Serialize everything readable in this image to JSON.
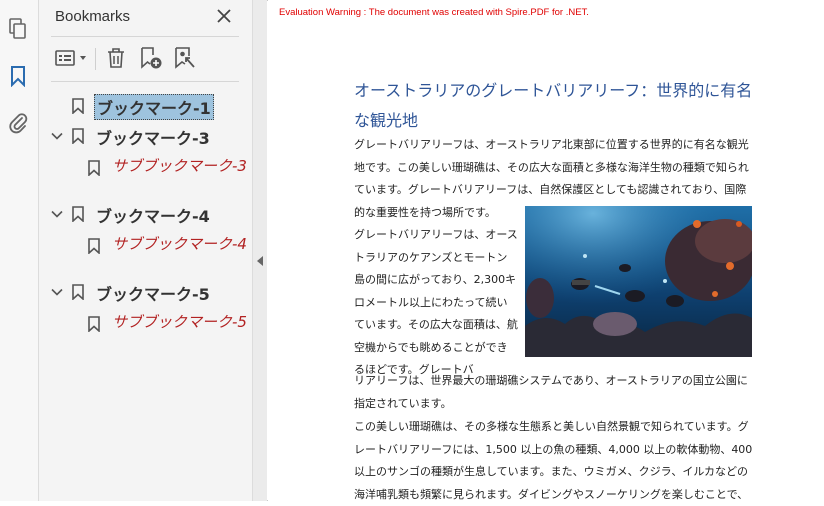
{
  "sidebar": {
    "title": "Bookmarks",
    "icons": [
      "pages-icon",
      "bookmark-panel-icon",
      "attachment-icon"
    ]
  },
  "toolbar": {
    "buttons": [
      "options-menu",
      "delete-bookmark",
      "new-bookmark",
      "bookmark-properties"
    ]
  },
  "bookmarks": {
    "b1": "ブックマーク-1",
    "b3": "ブックマーク-3",
    "b3_sub": "サブブックマーク-3",
    "b4": "ブックマーク-4",
    "b4_sub": "サブブックマーク-4",
    "b5": "ブックマーク-5",
    "b5_sub": "サブブックマーク-5"
  },
  "document": {
    "warning": "Evaluation Warning : The document was created with Spire.PDF for .NET.",
    "heading": "オーストラリアのグレートバリアリーフ：世界的に有名な観光地",
    "p1": "グレートバリアリーフは、オーストラリア北東部に位置する世界的に有名な観光地です。この美しい珊瑚礁は、その広大な面積と多様な海洋生物の種類で知られています。グレートバリアリーフは、自然保護区としても認識されており、国際的な重要性を持つ場所です。",
    "p2_left": "グレートバリアリーフは、オーストラリアのケアンズとモートン島の間に広がっており、2,300キロメートル以上にわたって続いています。その広大な面積は、航空機からでも眺めることができるほどです。グレートバ",
    "p2_rest": "リアリーフは、世界最大の珊瑚礁システムであり、オーストラリアの国立公園に指定されています。",
    "p3": "この美しい珊瑚礁は、その多様な生態系と美しい自然景観で知られています。グレートバリアリーフには、1,500 以上の魚の種類、4,000 以上の軟体動物、400 以上のサンゴの種類が生息しています。また、ウミガメ、クジラ、イルカなどの海洋哺乳類も頻繁に見られます。ダイビングやスノーケリングを楽しむことで、"
  },
  "colors": {
    "heading": "#2f5597",
    "warning": "#e00000",
    "sub_bookmark": "#b22222",
    "selection": "#9ec3de",
    "accent_icon": "#2b6cb0"
  }
}
